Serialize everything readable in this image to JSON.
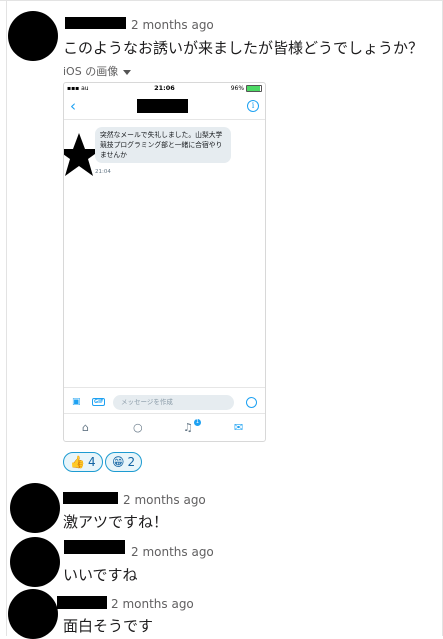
{
  "messages": [
    {
      "timestamp": "2 months ago",
      "text": "このようなお誘いが来ましたが皆様どうでしょうか？"
    },
    {
      "timestamp": "2 months ago",
      "text": "激アツですね！"
    },
    {
      "timestamp": "2 months ago",
      "text": "いいですね"
    },
    {
      "timestamp": "2 months ago",
      "text": "面白そうです"
    }
  ],
  "attachment": {
    "label": "iOS の画像"
  },
  "phone": {
    "carrier": "au",
    "time": "21:06",
    "battery": "96%",
    "dm_text": "突然なメールで失礼しました。山梨大学競技プログラミング部と一緒に合宿やりませんか",
    "dm_time": "21:04",
    "composer_placeholder": "メッセージを作成",
    "gif_label": "GIF",
    "notification_count": "1"
  },
  "reactions": [
    {
      "emoji": "👍",
      "count": "4"
    },
    {
      "emoji": "😁",
      "count": "2"
    }
  ],
  "colors": {
    "link_blue": "#1da1f2",
    "reaction_border": "#1d9bd1",
    "timestamp_gray": "#616061"
  }
}
